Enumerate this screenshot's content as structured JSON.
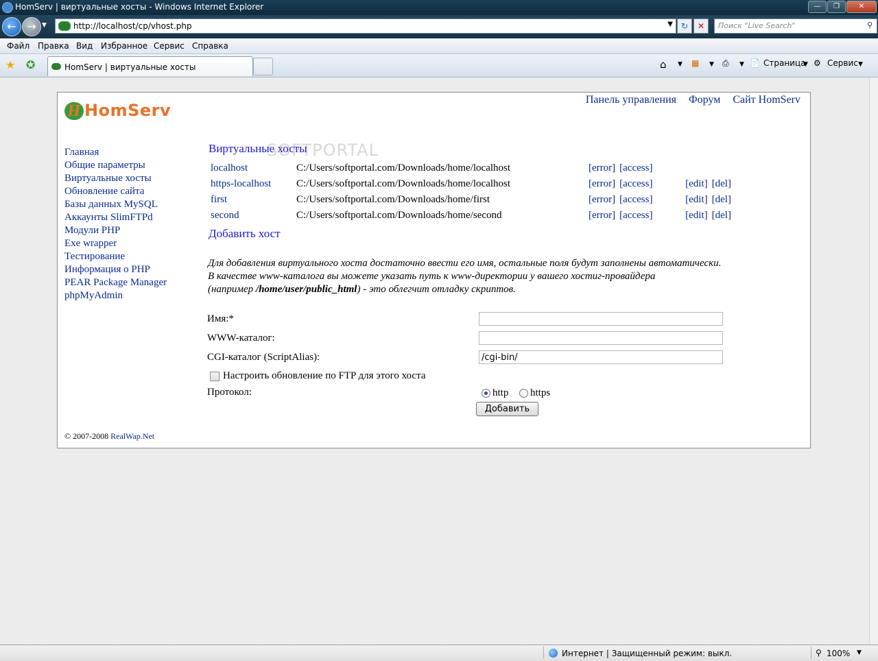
{
  "window": {
    "title": "HomServ | виртуальные хосты - Windows Internet Explorer"
  },
  "address": {
    "url": "http://localhost/cp/vhost.php",
    "search_placeholder": "Поиск \"Live Search\""
  },
  "menu": [
    "Файл",
    "Правка",
    "Вид",
    "Избранное",
    "Сервис",
    "Справка"
  ],
  "tab": {
    "title": "HomServ | виртуальные хосты"
  },
  "commandbar": {
    "page": "Страница",
    "tools": "Сервис"
  },
  "site": {
    "logo_h": "H",
    "logo_text": "HomServ",
    "toplinks": [
      "Панель управления",
      "Форум",
      "Сайт HomServ"
    ],
    "leftnav": [
      "Главная",
      "Общие параметры",
      "Виртуальные хосты",
      "Обновление сайта",
      "Базы данных MySQL",
      "Аккаунты SlimFTPd",
      "Модули PHP",
      "Exe wrapper",
      "Тестирование",
      "Информация о PHP",
      "PEAR Package Manager",
      "phpMyAdmin"
    ],
    "section_title": "Виртуальные хосты",
    "watermark": "SOFTPORTAL",
    "hosts": [
      {
        "name": "localhost",
        "path": "C:/Users/softportal.com/Downloads/home/localhost",
        "error": "[error]",
        "access": "[access]",
        "edit": "",
        "del": ""
      },
      {
        "name": "https-localhost",
        "path": "C:/Users/softportal.com/Downloads/home/localhost",
        "error": "[error]",
        "access": "[access]",
        "edit": "[edit]",
        "del": "[del]"
      },
      {
        "name": "first",
        "path": "C:/Users/softportal.com/Downloads/home/first",
        "error": "[error]",
        "access": "[access]",
        "edit": "[edit]",
        "del": "[del]"
      },
      {
        "name": "second",
        "path": "C:/Users/softportal.com/Downloads/home/second",
        "error": "[error]",
        "access": "[access]",
        "edit": "[edit]",
        "del": "[del]"
      }
    ],
    "add_host": "Добавить хост",
    "info_line1": "Для добавления виртуального хоста достаточно ввести его имя, остальные поля будут заполнены автоматически.",
    "info_line2": "В качестве www-каталога вы можете указать путь к www-директории у вашего хостиг-провайдера",
    "info_line3_a": "(например ",
    "info_line3_b": "/home/user/public_html",
    "info_line3_c": ") - это облегчит отладку скриптов.",
    "form": {
      "name_label": "Имя:*",
      "name_value": "",
      "www_label": "WWW-каталог:",
      "www_value": "",
      "cgi_label": "CGI-каталог (ScriptAlias):",
      "cgi_value": "/cgi-bin/",
      "ftp_checkbox_label": "Настроить обновление по FTP для этого хоста",
      "protocol_label": "Протокол:",
      "protocol_options": [
        "http",
        "https"
      ],
      "protocol_selected": "http",
      "submit": "Добавить"
    },
    "copyright_a": "© 2007-2008 ",
    "copyright_b": "RealWap.Net"
  },
  "statusbar": {
    "zone": "Интернет | Защищенный режим: выкл.",
    "zoom": "100%"
  }
}
